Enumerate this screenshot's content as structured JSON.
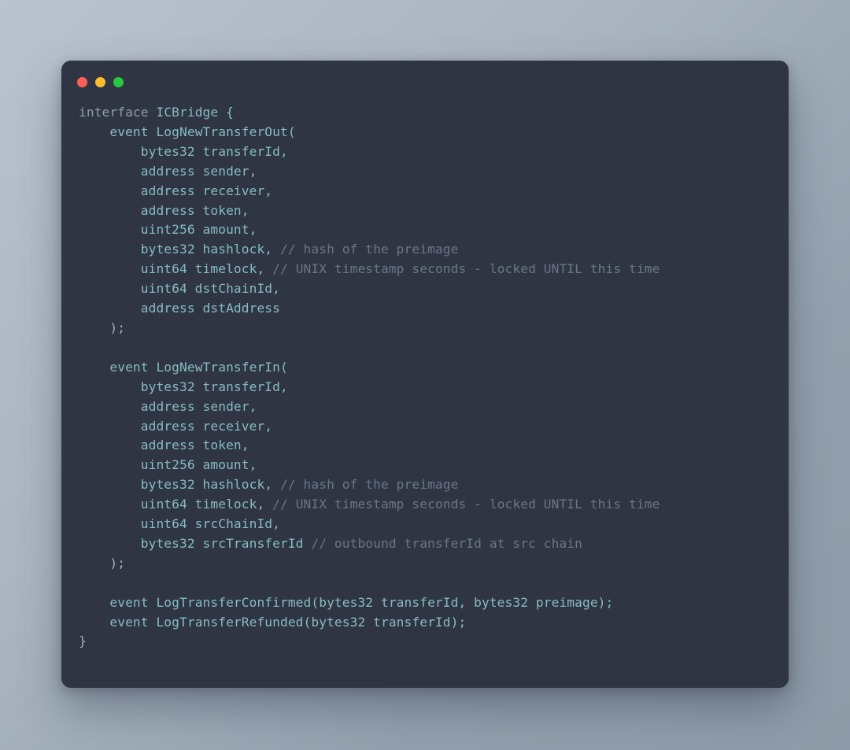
{
  "theme": {
    "page_background_from": "#b9c3cd",
    "page_background_to": "#8e9ba8",
    "window_background": "#2f3542",
    "keyword_color": "#8e9cb0",
    "identifier_color": "#86bcc4",
    "punctuation_color": "#a4b1c2",
    "comment_color": "#6b7689"
  },
  "window": {
    "traffic_lights": [
      {
        "name": "close-button",
        "color": "#ff5f56"
      },
      {
        "name": "minimize-button",
        "color": "#ffbd2e"
      },
      {
        "name": "maximize-button",
        "color": "#27c93f"
      }
    ]
  },
  "code": {
    "language": "solidity",
    "plain_text": "interface ICBridge {\n    event LogNewTransferOut(\n        bytes32 transferId,\n        address sender,\n        address receiver,\n        address token,\n        uint256 amount,\n        bytes32 hashlock, // hash of the preimage\n        uint64 timelock, // UNIX timestamp seconds - locked UNTIL this time\n        uint64 dstChainId,\n        address dstAddress\n    );\n\n    event LogNewTransferIn(\n        bytes32 transferId,\n        address sender,\n        address receiver,\n        address token,\n        uint256 amount,\n        bytes32 hashlock, // hash of the preimage\n        uint64 timelock, // UNIX timestamp seconds - locked UNTIL this time\n        uint64 srcChainId,\n        bytes32 srcTransferId // outbound transferId at src chain\n    );\n\n    event LogTransferConfirmed(bytes32 transferId, bytes32 preimage);\n    event LogTransferRefunded(bytes32 transferId);\n}",
    "lines": [
      {
        "n": 1,
        "indent": 0,
        "segments": [
          {
            "t": "kw",
            "s": "interface "
          },
          {
            "t": "ident",
            "s": "ICBridge {"
          }
        ]
      },
      {
        "n": 2,
        "indent": 1,
        "segments": [
          {
            "t": "ident",
            "s": "event LogNewTransferOut("
          }
        ]
      },
      {
        "n": 3,
        "indent": 2,
        "segments": [
          {
            "t": "ident",
            "s": "bytes32 transferId,"
          }
        ]
      },
      {
        "n": 4,
        "indent": 2,
        "segments": [
          {
            "t": "ident",
            "s": "address sender,"
          }
        ]
      },
      {
        "n": 5,
        "indent": 2,
        "segments": [
          {
            "t": "ident",
            "s": "address receiver,"
          }
        ]
      },
      {
        "n": 6,
        "indent": 2,
        "segments": [
          {
            "t": "ident",
            "s": "address token,"
          }
        ]
      },
      {
        "n": 7,
        "indent": 2,
        "segments": [
          {
            "t": "ident",
            "s": "uint256 amount,"
          }
        ]
      },
      {
        "n": 8,
        "indent": 2,
        "segments": [
          {
            "t": "ident",
            "s": "bytes32 hashlock, "
          },
          {
            "t": "cmt",
            "s": "// hash of the preimage"
          }
        ]
      },
      {
        "n": 9,
        "indent": 2,
        "segments": [
          {
            "t": "ident",
            "s": "uint64 timelock, "
          },
          {
            "t": "cmt",
            "s": "// UNIX timestamp seconds - locked UNTIL this time"
          }
        ]
      },
      {
        "n": 10,
        "indent": 2,
        "segments": [
          {
            "t": "ident",
            "s": "uint64 dstChainId,"
          }
        ]
      },
      {
        "n": 11,
        "indent": 2,
        "segments": [
          {
            "t": "ident",
            "s": "address dstAddress"
          }
        ]
      },
      {
        "n": 12,
        "indent": 1,
        "segments": [
          {
            "t": "punct",
            "s": ");"
          }
        ]
      },
      {
        "n": 13,
        "indent": 0,
        "segments": []
      },
      {
        "n": 14,
        "indent": 1,
        "segments": [
          {
            "t": "ident",
            "s": "event LogNewTransferIn("
          }
        ]
      },
      {
        "n": 15,
        "indent": 2,
        "segments": [
          {
            "t": "ident",
            "s": "bytes32 transferId,"
          }
        ]
      },
      {
        "n": 16,
        "indent": 2,
        "segments": [
          {
            "t": "ident",
            "s": "address sender,"
          }
        ]
      },
      {
        "n": 17,
        "indent": 2,
        "segments": [
          {
            "t": "ident",
            "s": "address receiver,"
          }
        ]
      },
      {
        "n": 18,
        "indent": 2,
        "segments": [
          {
            "t": "ident",
            "s": "address token,"
          }
        ]
      },
      {
        "n": 19,
        "indent": 2,
        "segments": [
          {
            "t": "ident",
            "s": "uint256 amount,"
          }
        ]
      },
      {
        "n": 20,
        "indent": 2,
        "segments": [
          {
            "t": "ident",
            "s": "bytes32 hashlock, "
          },
          {
            "t": "cmt",
            "s": "// hash of the preimage"
          }
        ]
      },
      {
        "n": 21,
        "indent": 2,
        "segments": [
          {
            "t": "ident",
            "s": "uint64 timelock, "
          },
          {
            "t": "cmt",
            "s": "// UNIX timestamp seconds - locked UNTIL this time"
          }
        ]
      },
      {
        "n": 22,
        "indent": 2,
        "segments": [
          {
            "t": "ident",
            "s": "uint64 srcChainId,"
          }
        ]
      },
      {
        "n": 23,
        "indent": 2,
        "segments": [
          {
            "t": "ident",
            "s": "bytes32 srcTransferId "
          },
          {
            "t": "cmt",
            "s": "// outbound transferId at src chain"
          }
        ]
      },
      {
        "n": 24,
        "indent": 1,
        "segments": [
          {
            "t": "punct",
            "s": ");"
          }
        ]
      },
      {
        "n": 25,
        "indent": 0,
        "segments": []
      },
      {
        "n": 26,
        "indent": 1,
        "segments": [
          {
            "t": "ident",
            "s": "event LogTransferConfirmed(bytes32 transferId, bytes32 preimage);"
          }
        ]
      },
      {
        "n": 27,
        "indent": 1,
        "segments": [
          {
            "t": "ident",
            "s": "event LogTransferRefunded(bytes32 transferId);"
          }
        ]
      },
      {
        "n": 28,
        "indent": 0,
        "segments": [
          {
            "t": "punct",
            "s": "}"
          }
        ]
      }
    ]
  }
}
